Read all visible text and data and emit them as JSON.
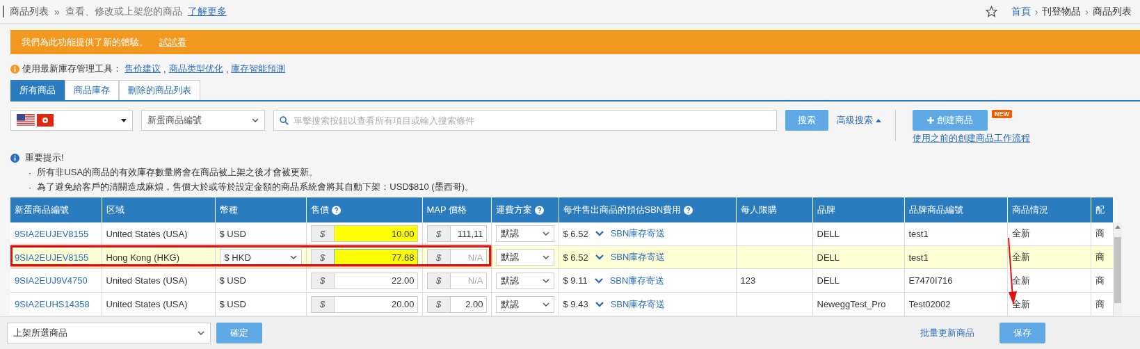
{
  "breadcrumb": {
    "title": "商品列表",
    "separator": "»",
    "description": "查看、修改或上架您的商品",
    "link": "了解更多"
  },
  "top_nav": {
    "separator": "›",
    "items": [
      {
        "label": "首頁",
        "link": true
      },
      {
        "label": "刊登物品",
        "link": false
      },
      {
        "label": "商品列表",
        "link": false
      }
    ]
  },
  "banner": {
    "text": "我們為此功能提供了新的體驗。",
    "link": "試試看"
  },
  "tools": {
    "label": "使用最新庫存管理工具：",
    "separator": ",",
    "links": [
      "售价建议",
      "商品类型优化",
      "庫存智能預測"
    ]
  },
  "tabs": [
    {
      "label": "所有商品",
      "selected": true
    },
    {
      "label": "商品庫存",
      "selected": false
    },
    {
      "label": "刪除的商品列表",
      "selected": false
    }
  ],
  "filters": {
    "field_select": "新蛋商品編號",
    "search_placeholder": "單擊搜索按鈕以查看所有項目或輸入搜索條件",
    "search_button": "搜索",
    "advanced_search": "高級搜索",
    "create_button": "創建商品",
    "new_badge": "NEW",
    "old_flow_link": "使用之前的創建商品工作流程"
  },
  "notice": {
    "title": "重要提示!",
    "bullet": "·",
    "items": [
      "所有非USA的商品的有效庫存數量將會在商品被上架之後才會被更新。",
      "為了避免給客戶的清關造成麻煩，售價大於或等於設定金額的商品系統會將其自動下架：USD$810 (墨西哥)。"
    ]
  },
  "table": {
    "columns": [
      {
        "label": "新蛋商品編號",
        "help": false
      },
      {
        "label": "区域",
        "help": false
      },
      {
        "label": "幣種",
        "help": false
      },
      {
        "label": "售價",
        "help": true
      },
      {
        "label": "MAP 價格",
        "help": false
      },
      {
        "label": "運費方案",
        "help": true
      },
      {
        "label": "每件售出商品的預估SBN費用",
        "help": true
      },
      {
        "label": "每人限購",
        "help": false
      },
      {
        "label": "品牌",
        "help": false
      },
      {
        "label": "品牌商品編號",
        "help": false
      },
      {
        "label": "商品情況",
        "help": false
      },
      {
        "label": "配",
        "help": false
      }
    ],
    "rows": [
      {
        "highlighted": false,
        "annotated": false,
        "item_number": "9SIA2EUJEV8155",
        "region": "United States (USA)",
        "currency": "$ USD",
        "currency_editable": false,
        "price_prefix": "$",
        "price": "10.00",
        "price_highlighted": true,
        "price_focused": false,
        "map_prefix": "$",
        "map_value": "111,11",
        "shipping": "默認",
        "sbn_fee": "$ 6.52",
        "sbn_method": "SBN庫存寄送",
        "brand": "DELL",
        "brand_item": "test1",
        "condition": "全新",
        "delivery": "商"
      },
      {
        "highlighted": true,
        "annotated": true,
        "item_number": "9SIA2EUJEV8155",
        "region": "Hong Kong (HKG)",
        "currency": "$ HKD",
        "currency_editable": true,
        "price_prefix": "$",
        "price": "77.68",
        "price_highlighted": true,
        "price_focused": true,
        "map_prefix": "$",
        "map_placeholder": "N/A",
        "shipping": "默認",
        "sbn_fee": "$ 6.52",
        "sbn_method": "SBN庫存寄送",
        "brand": "DELL",
        "brand_item": "test1",
        "condition": "全新",
        "delivery": "商"
      },
      {
        "highlighted": false,
        "annotated": false,
        "item_number": "9SIA2EUJ9V4750",
        "region": "United States (USA)",
        "currency": "$ USD",
        "currency_editable": false,
        "price_prefix": "$",
        "price": "22.00",
        "price_highlighted": false,
        "price_focused": false,
        "map_prefix": "$",
        "map_placeholder": "N/A",
        "shipping": "默認",
        "sbn_fee": "$ 9.11",
        "sbn_method": "SBN庫存寄送",
        "limit": "123",
        "brand": "DELL",
        "brand_item": "E7470I716",
        "condition": "全新",
        "delivery": "商"
      },
      {
        "highlighted": false,
        "annotated": false,
        "item_number": "9SIA2EUHS14358",
        "region": "United States (USA)",
        "currency": "$ USD",
        "currency_editable": false,
        "price_prefix": "$",
        "price": "20.00",
        "price_highlighted": false,
        "price_focused": false,
        "map_prefix": "$",
        "map_value": "2.00",
        "shipping": "默認",
        "sbn_fee": "$ 9.43",
        "sbn_method": "SBN庫存寄送",
        "brand": "NeweggTest_Pro",
        "brand_item": "Test02002",
        "condition": "全新",
        "delivery": "商"
      }
    ]
  },
  "footer": {
    "action_select": "上架所選商品",
    "confirm_button": "確定",
    "bulk_update_link": "批量更新商品",
    "save_button": "保存"
  },
  "annotation_arrow": true
}
